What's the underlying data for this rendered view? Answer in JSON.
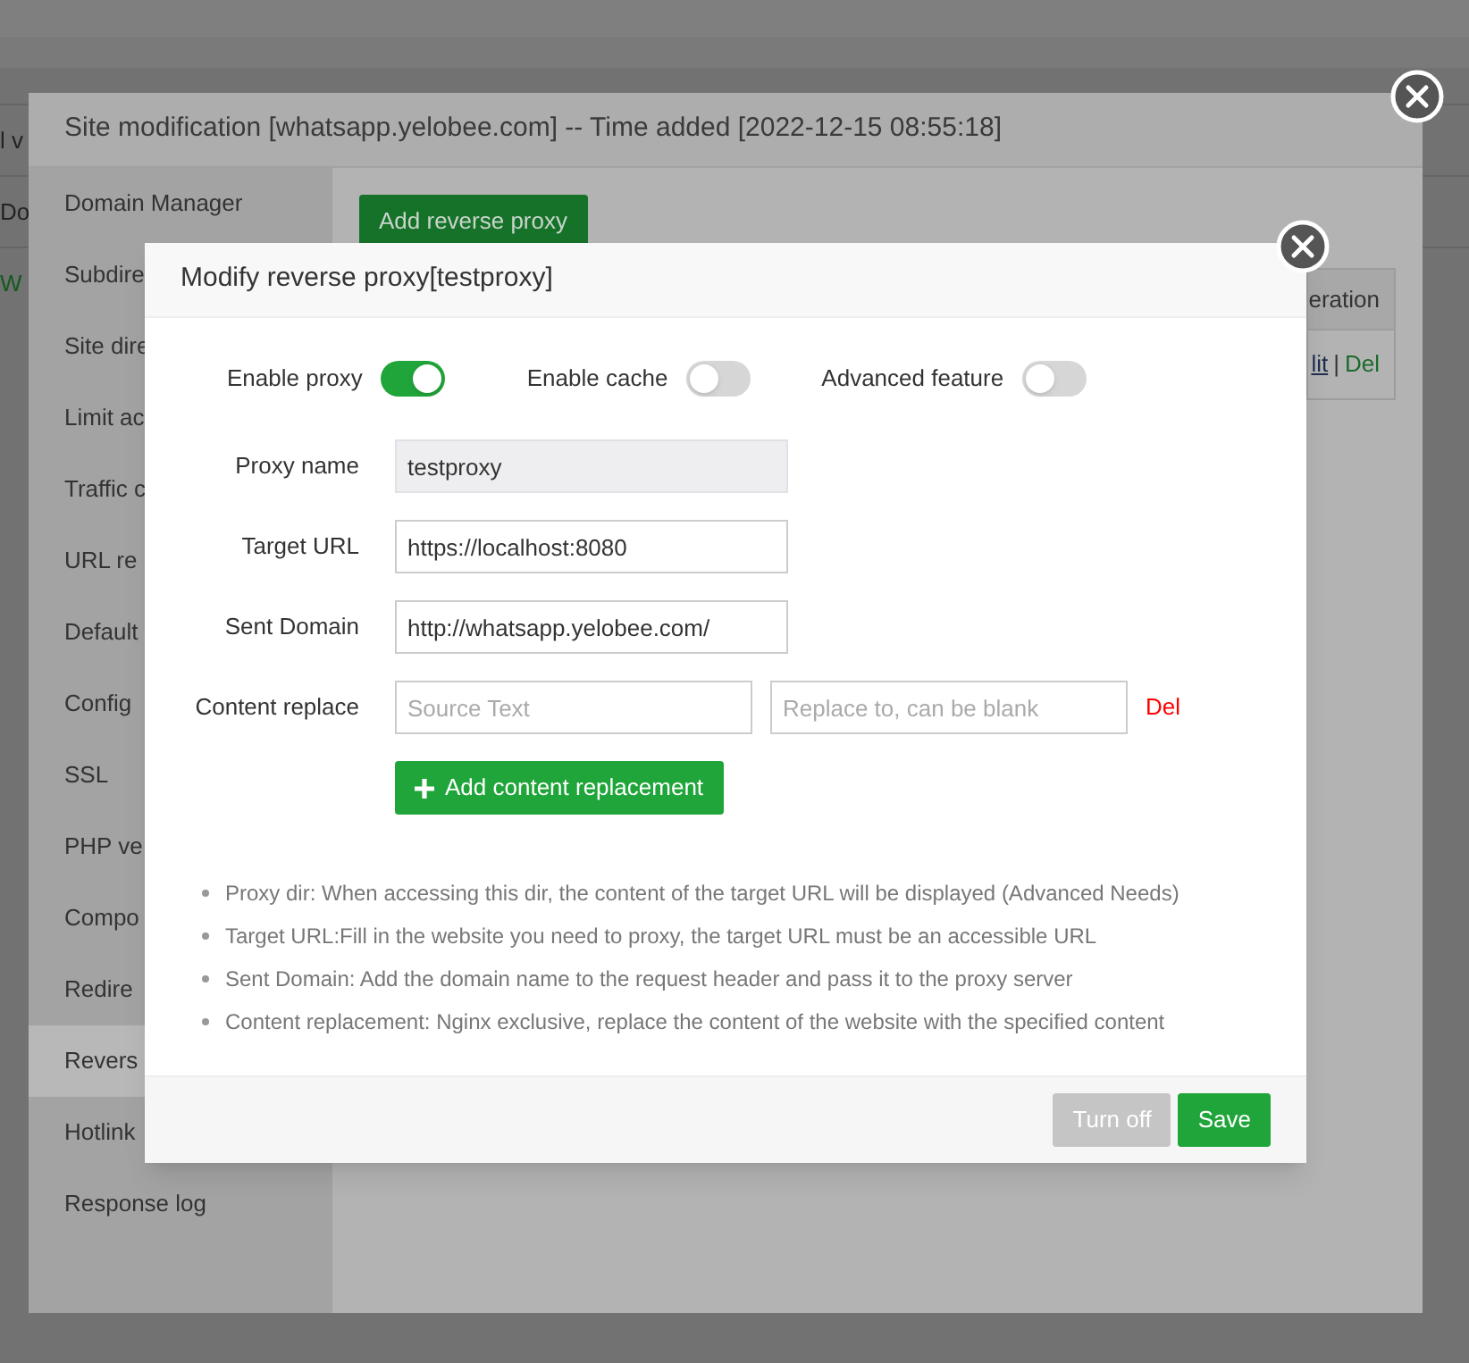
{
  "background_page": {
    "texts": [
      {
        "text": "l v",
        "kind": "text"
      },
      {
        "text": "Do",
        "kind": "text"
      },
      {
        "text": "W",
        "kind": "link"
      }
    ]
  },
  "site_dialog": {
    "title": "Site modification [whatsapp.yelobee.com] -- Time added [2022-12-15 08:55:18]",
    "sidebar": {
      "items": [
        {
          "label": "Domain Manager",
          "selected": false
        },
        {
          "label": "Subdire",
          "selected": false
        },
        {
          "label": "Site dire",
          "selected": false
        },
        {
          "label": "Limit ac",
          "selected": false
        },
        {
          "label": "Traffic c",
          "selected": false
        },
        {
          "label": "URL re",
          "selected": false
        },
        {
          "label": "Default",
          "selected": false
        },
        {
          "label": "Config",
          "selected": false
        },
        {
          "label": "SSL",
          "selected": false
        },
        {
          "label": "PHP ve",
          "selected": false
        },
        {
          "label": "Compo",
          "selected": false
        },
        {
          "label": "Redire",
          "selected": false
        },
        {
          "label": "Revers",
          "selected": true
        },
        {
          "label": "Hotlink",
          "selected": false
        },
        {
          "label": "Response log",
          "selected": false
        }
      ]
    },
    "add_button": "Add reverse proxy",
    "table": {
      "columns": [
        "eration"
      ],
      "rows": [
        {
          "edit": "lit",
          "separator": "|",
          "delete": "Del"
        }
      ]
    }
  },
  "proxy_dialog": {
    "title": "Modify reverse proxy[testproxy]",
    "toggles": [
      {
        "label": "Enable proxy",
        "on": true
      },
      {
        "label": "Enable cache",
        "on": false
      },
      {
        "label": "Advanced feature",
        "on": false
      }
    ],
    "fields": [
      {
        "label": "Proxy name",
        "value": "testproxy",
        "disabled": true
      },
      {
        "label": "Target URL",
        "value": "https://localhost:8080",
        "disabled": false
      },
      {
        "label": "Sent Domain",
        "value": "http://whatsapp.yelobee.com/",
        "disabled": false
      }
    ],
    "content_replace": {
      "label": "Content replace",
      "source_placeholder": "Source Text",
      "target_placeholder": "Replace to, can be blank",
      "delete": "Del"
    },
    "add_button": "Add content replacement",
    "notes": [
      "Proxy dir: When accessing this dir, the content of the target URL will be displayed (Advanced Needs)",
      "Target URL:Fill in the website you need to proxy, the target URL must be an accessible URL",
      "Sent Domain: Add the domain name to the request header and pass it to the proxy server",
      "Content replacement: Nginx exclusive, replace the content of the website with the specified content"
    ],
    "buttons": [
      {
        "label": "Turn off",
        "kind": "secondary"
      },
      {
        "label": "Save",
        "kind": "primary"
      }
    ]
  }
}
